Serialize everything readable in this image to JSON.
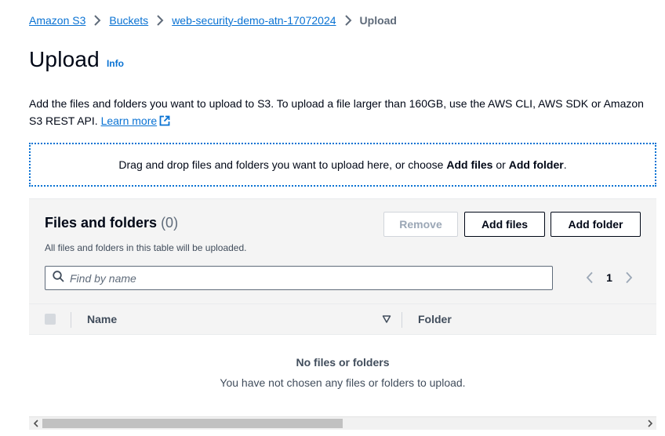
{
  "breadcrumb": {
    "items": [
      "Amazon S3",
      "Buckets",
      "web-security-demo-atn-17072024"
    ],
    "current": "Upload"
  },
  "page": {
    "title": "Upload",
    "info": "Info"
  },
  "description": {
    "text": "Add the files and folders you want to upload to S3. To upload a file larger than 160GB, use the AWS CLI, AWS SDK or Amazon S3 REST API. ",
    "learn_more": "Learn more"
  },
  "dropzone": {
    "text_before": "Drag and drop files and folders you want to upload here, or choose ",
    "add_files": "Add files",
    "or": " or ",
    "add_folder": "Add folder",
    "period": "."
  },
  "files_panel": {
    "title": "Files and folders",
    "count": "(0)",
    "subtitle": "All files and folders in this table will be uploaded.",
    "buttons": {
      "remove": "Remove",
      "add_files": "Add files",
      "add_folder": "Add folder"
    },
    "search": {
      "placeholder": "Find by name",
      "value": ""
    },
    "pagination": {
      "page": "1"
    },
    "columns": [
      "Name",
      "Folder"
    ],
    "empty": {
      "title": "No files or folders",
      "message": "You have not chosen any files or folders to upload."
    }
  },
  "colors": {
    "link": "#0972d3",
    "text": "#000716",
    "muted": "#5f6b7a"
  },
  "icons": {
    "breadcrumb_separator": "chevron-right-icon",
    "external": "external-link-icon",
    "search": "search-icon",
    "prev": "chevron-left-icon",
    "next": "chevron-right-icon",
    "sort": "sort-descending-icon"
  }
}
